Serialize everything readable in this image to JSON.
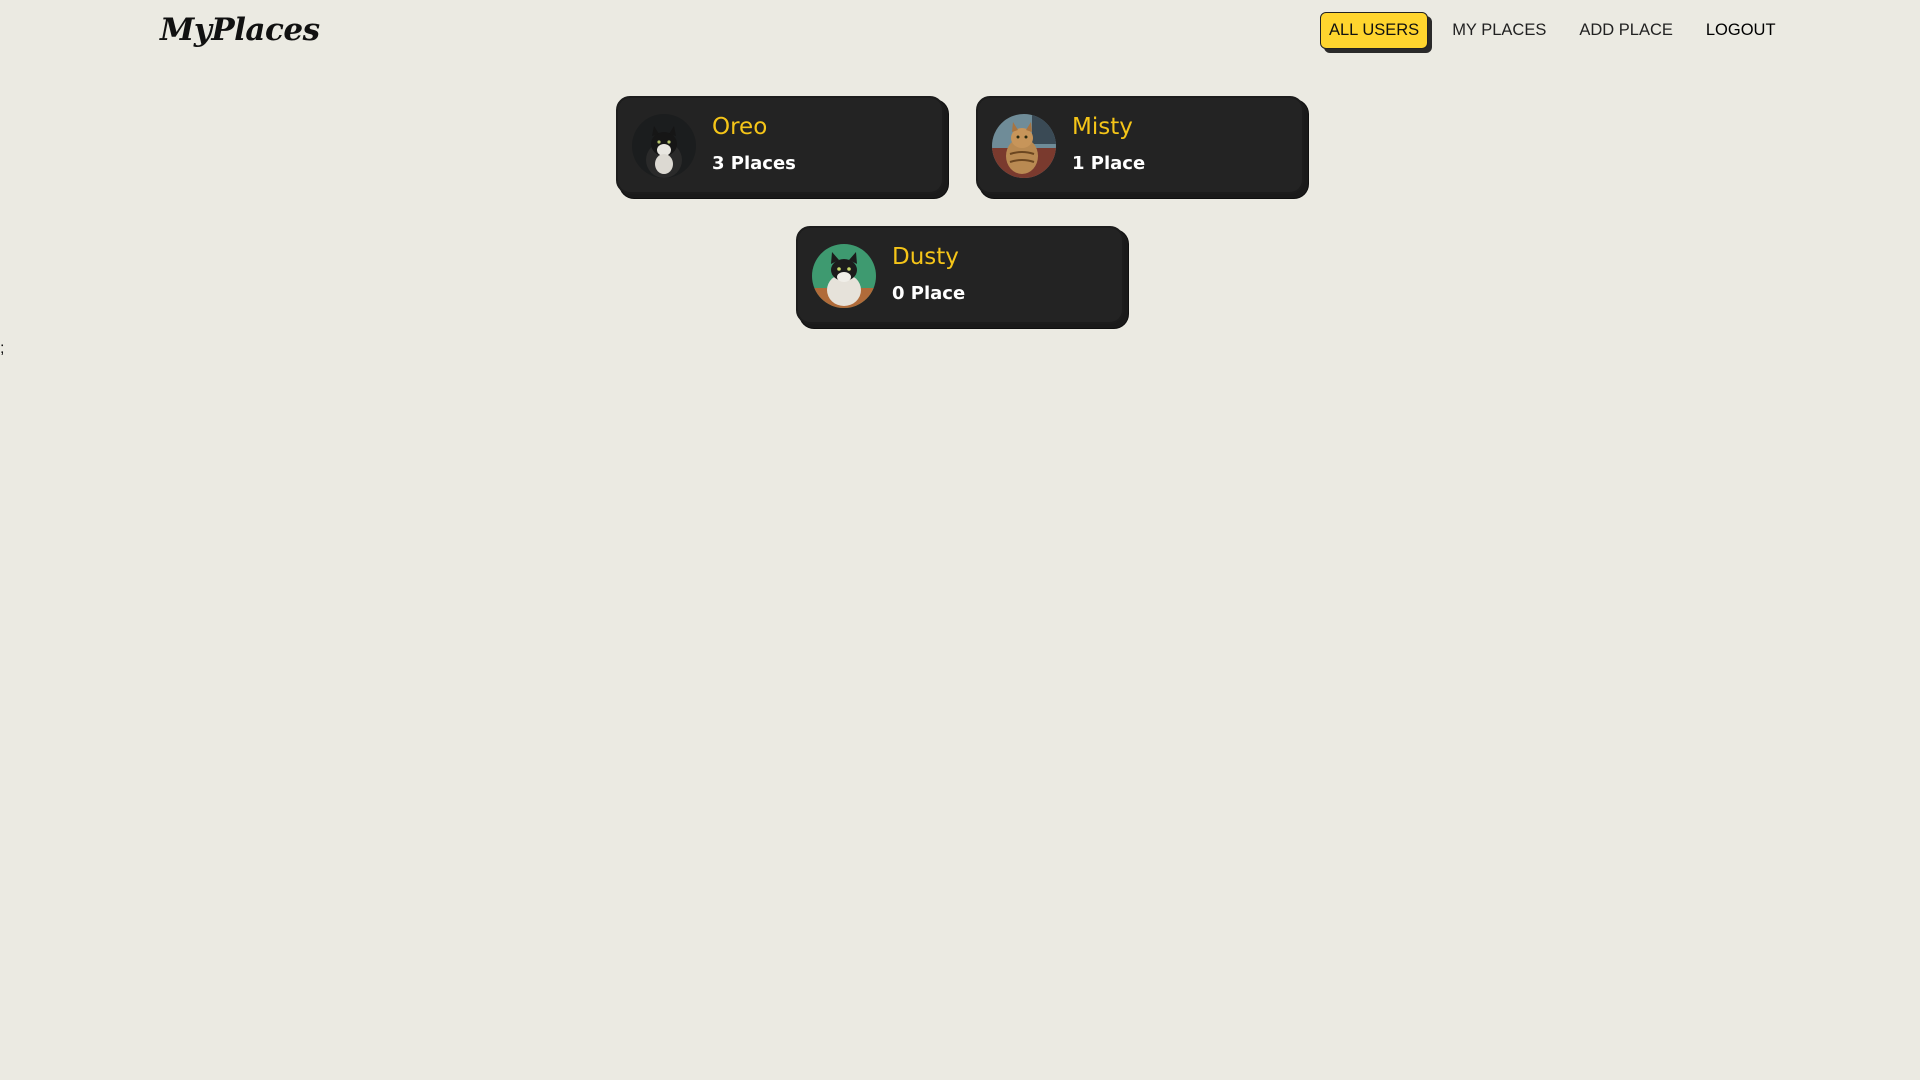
{
  "app": {
    "logo": "MyPlaces"
  },
  "nav": {
    "items": [
      {
        "label": "ALL USERS",
        "active": true
      },
      {
        "label": "MY PLACES",
        "active": false
      },
      {
        "label": "ADD PLACE",
        "active": false
      },
      {
        "label": "LOGOUT",
        "active": false
      }
    ]
  },
  "users": [
    {
      "name": "Oreo",
      "places": "3 Places",
      "avatar_icon": "black-white-cat-avatar"
    },
    {
      "name": "Misty",
      "places": "1 Place",
      "avatar_icon": "tabby-cat-avatar"
    },
    {
      "name": "Dusty",
      "places": "0 Place",
      "avatar_icon": "tuxedo-cat-avatar"
    }
  ],
  "stray_text": ";",
  "colors": {
    "background": "#ebeae2",
    "accent": "#ffd52e",
    "card": "#232323",
    "name": "#f5c518"
  }
}
